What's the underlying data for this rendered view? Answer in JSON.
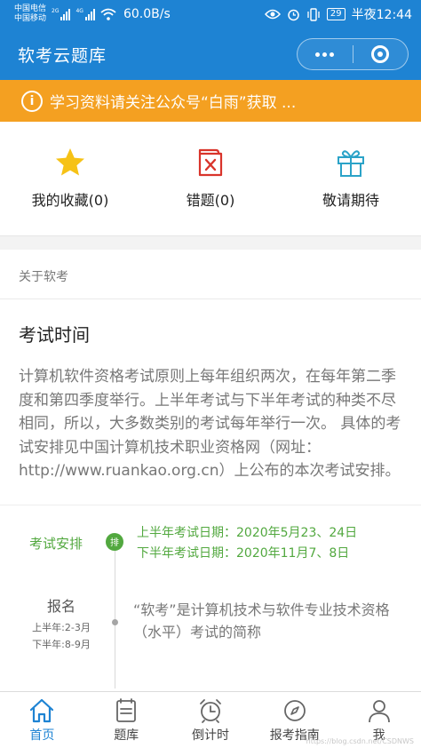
{
  "status_bar": {
    "carrier_1": "中国电信",
    "carrier_2": "中国移动",
    "sig_label_1": "2G",
    "sig_label_2": "4G",
    "speed": "60.0B/s",
    "battery": "29",
    "time": "半夜12:44"
  },
  "nav": {
    "title": "软考云题库"
  },
  "notice": {
    "text": "学习资料请关注公众号“白雨”获取 ..."
  },
  "features": [
    {
      "label": "我的收藏(0)",
      "icon": "star-icon"
    },
    {
      "label": "错题(0)",
      "icon": "wrong-question-icon"
    },
    {
      "label": "敬请期待",
      "icon": "gift-icon"
    }
  ],
  "about": {
    "header": "关于软考",
    "title": "考试时间",
    "text": "计算机软件资格考试原则上每年组织两次，在每年第二季度和第四季度举行。上半年考试与下半年考试的种类不尽相同，所以，大多数类别的考试每年举行一次。 具体的考试安排见中国计算机技术职业资格网（网址：http://www.ruankao.org.cn）上公布的本次考试安排。"
  },
  "timeline": {
    "schedule_label": "考试安排",
    "badge": "排",
    "first_half": "上半年考试日期：2020年5月23、24日",
    "second_half": "下半年考试日期：2020年11月7、8日",
    "registration_title": "报名",
    "registration_first": "上半年:2-3月",
    "registration_second": "下半年:8-9月",
    "description": "“软考”是计算机技术与软件专业技术资格（水平）考试的简称"
  },
  "tabbar": [
    {
      "label": "首页",
      "icon": "home-icon",
      "active": true
    },
    {
      "label": "题库",
      "icon": "question-bank-icon",
      "active": false
    },
    {
      "label": "倒计时",
      "icon": "alarm-clock-icon",
      "active": false
    },
    {
      "label": "报考指南",
      "icon": "compass-icon",
      "active": false
    },
    {
      "label": "我",
      "icon": "user-icon",
      "active": false
    }
  ],
  "watermark": "https://blog.csdn.net/CSDNWS",
  "colors": {
    "primary": "#1e83d3",
    "notice": "#f4a021",
    "green": "#52a83f",
    "star": "#f6c216",
    "red": "#d9342b",
    "teal": "#2ba3c8"
  }
}
